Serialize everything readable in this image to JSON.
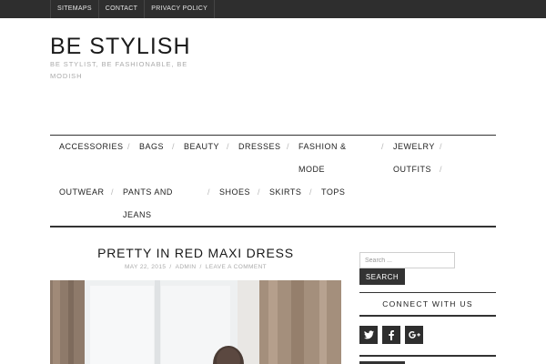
{
  "top_nav": {
    "items": [
      "SITEMAPS",
      "CONTACT",
      "PRIVACY POLICY"
    ]
  },
  "header": {
    "title": "BE STYLISH",
    "description": "BE STYLIST, BE FASHIONABLE, BE MODISH"
  },
  "main_nav": {
    "items": [
      "ACCESSORIES",
      "BAGS",
      "BEAUTY",
      "DRESSES",
      "FASHION &",
      "MODE",
      "JEWELRY",
      "OUTFITS",
      "OUTWEAR",
      "PANTS AND",
      "JEANS",
      "SHOES",
      "SKIRTS",
      "TOPS"
    ],
    "separator": "/"
  },
  "post": {
    "title": "PRETTY IN RED MAXI DRESS",
    "date": "MAY 22, 2015",
    "author": "ADMIN",
    "comment_link": "LEAVE A COMMENT",
    "meta_separator": "/"
  },
  "sidebar": {
    "search_placeholder": "Search ...",
    "search_button": "SEARCH",
    "connect_title": "CONNECT WITH US",
    "social_icons": [
      "twitter-icon",
      "facebook-icon",
      "google-plus-icon"
    ]
  },
  "colors": {
    "dark": "#2e2e2e",
    "text": "#222222",
    "muted": "#aaaaaa",
    "separator": "#b8b8b8"
  }
}
